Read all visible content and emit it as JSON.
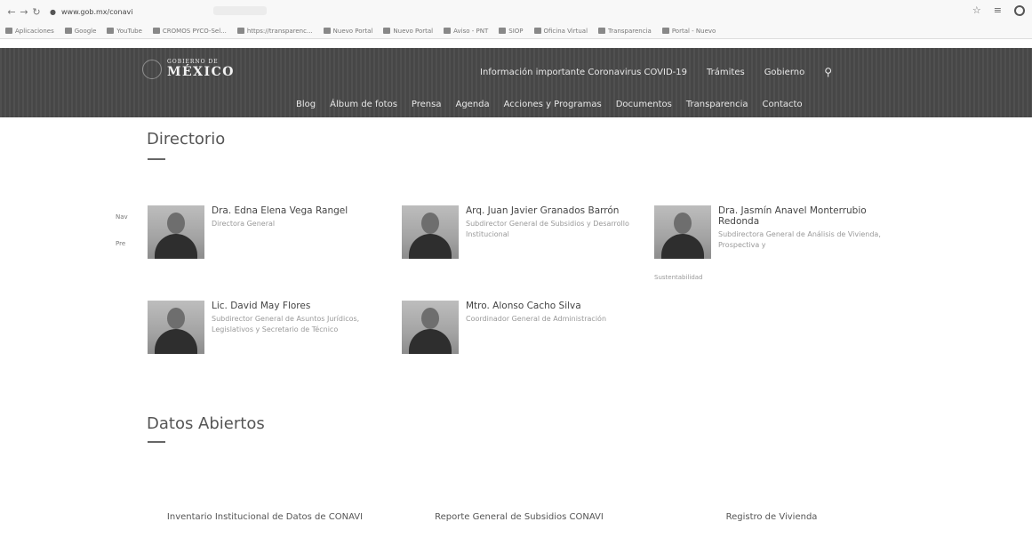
{
  "browser": {
    "url": "www.gob.mx/conavi",
    "bookmarks": [
      "Aplicaciones",
      "Google",
      "YouTube",
      "CROMOS PYCO-Sel...",
      "https://transparenc...",
      "Nuevo Portal",
      "Nuevo Portal",
      "Aviso - PNT",
      "SIOP",
      "Oficina Virtual",
      "Transparencia",
      "Portal - Nuevo"
    ]
  },
  "header": {
    "logo_small": "GOBIERNO DE",
    "logo_big": "MÉXICO",
    "top_nav": [
      "Información importante Coronavirus COVID-19",
      "Trámites",
      "Gobierno"
    ],
    "main_nav": [
      "Blog",
      "Álbum de fotos",
      "Prensa",
      "Agenda",
      "Acciones y Programas",
      "Documentos",
      "Transparencia",
      "Contacto"
    ]
  },
  "directorio": {
    "title": "Directorio",
    "side_labels": [
      "Nav",
      "Pre"
    ],
    "people": [
      {
        "name": "Dra. Edna Elena Vega Rangel",
        "role": "Directora General",
        "extra": ""
      },
      {
        "name": "Arq. Juan Javier Granados Barrón",
        "role": "Subdirector General de Subsidios y Desarrollo Institucional",
        "extra": ""
      },
      {
        "name": "Dra. Jasmín Anavel Monterrubio Redonda",
        "role": "Subdirectora General de Análisis de Vivienda, Prospectiva y",
        "extra": "Sustentabilidad"
      },
      {
        "name": "Lic. David May Flores",
        "role": "Subdirector General de Asuntos Jurídicos, Legislativos y Secretario de Técnico",
        "extra": ""
      },
      {
        "name": "Mtro. Alonso Cacho Silva",
        "role": "Coordinador General de Administración",
        "extra": ""
      }
    ]
  },
  "datos_abiertos": {
    "title": "Datos Abiertos",
    "items": [
      "Inventario Institucional de Datos de CONAVI",
      "Reporte General de Subsidios CONAVI",
      "Registro de Vivienda"
    ]
  }
}
